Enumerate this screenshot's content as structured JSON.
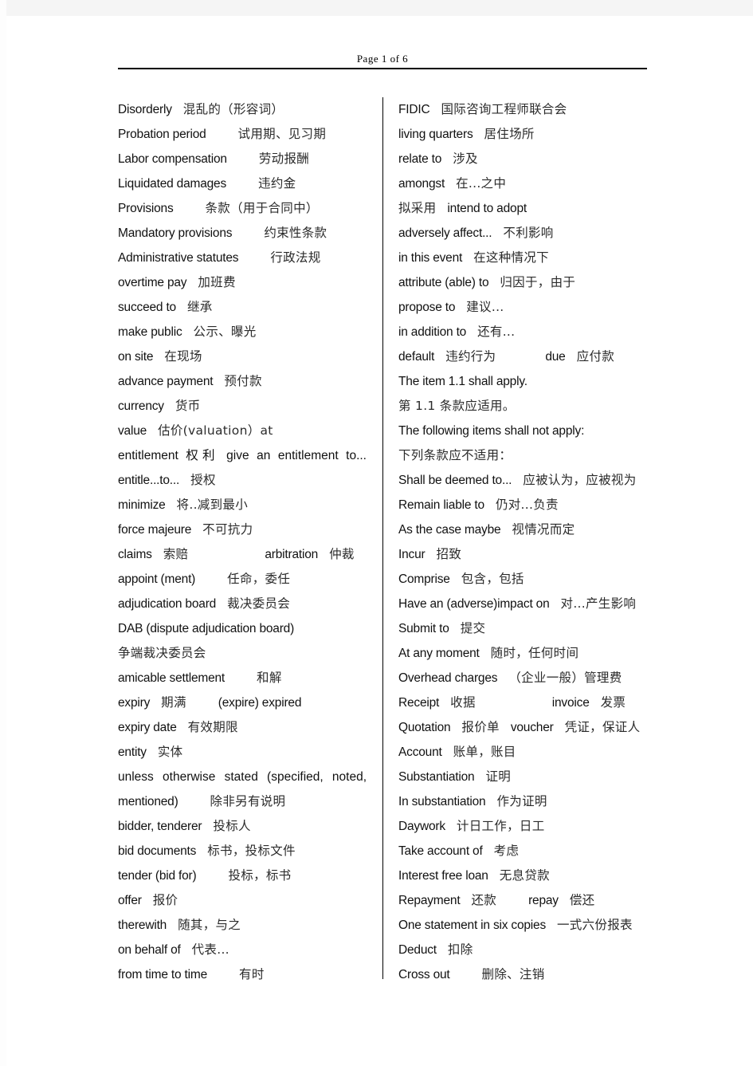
{
  "header": {
    "page_label": "Page 1 of 6"
  },
  "columns": {
    "left": [
      {
        "en": "Disorderly",
        "cn": "混乱的（形容词）",
        "gap": "gap-sm"
      },
      {
        "en": "Probation period",
        "cn": "试用期、见习期",
        "gap": "gap-md"
      },
      {
        "en": "Labor compensation",
        "cn": "劳动报酬",
        "gap": "gap-md"
      },
      {
        "en": "Liquidated damages",
        "cn": "违约金",
        "gap": "gap-md"
      },
      {
        "en": "Provisions",
        "cn": "条款（用于合同中）",
        "gap": "gap-md"
      },
      {
        "en": "Mandatory provisions",
        "cn": "约束性条款",
        "gap": "gap-md"
      },
      {
        "en": "Administrative statutes",
        "cn": "行政法规",
        "gap": "gap-md"
      },
      {
        "en": "overtime pay",
        "cn": "加班费",
        "gap": "gap-sm"
      },
      {
        "en": "succeed to",
        "cn": "继承",
        "gap": "gap-sm"
      },
      {
        "en": "make public",
        "cn": "公示、曝光",
        "gap": "gap-sm"
      },
      {
        "en": "on site",
        "cn": "在现场",
        "gap": "gap-sm"
      },
      {
        "en": "advance payment",
        "cn": "预付款",
        "gap": "gap-sm"
      },
      {
        "en": "currency",
        "cn": "货币",
        "gap": "gap-sm"
      },
      {
        "en": "value",
        "cn": "估价(valuation）at",
        "gap": "gap-sm"
      },
      {
        "justified": true,
        "text": "entitlement 权利 give an entitlement to..."
      },
      {
        "en": "entitle...to...",
        "cn": "授权",
        "gap": "gap-sm"
      },
      {
        "en": "minimize",
        "cn": "将..减到最小",
        "gap": "gap-sm"
      },
      {
        "en": "force majeure",
        "cn": "不可抗力",
        "gap": "gap-sm"
      },
      {
        "en": "claims",
        "cn": "索赔",
        "gap": "gap-sm",
        "en2": "arbitration",
        "cn2": "仲裁",
        "gap2": "gap-xl"
      },
      {
        "en": "appoint (ment)",
        "cn": "任命，委任",
        "gap": "gap-md"
      },
      {
        "en": "adjudication board",
        "cn": "裁决委员会",
        "gap": "gap-sm"
      },
      {
        "en": "DAB (dispute adjudication board)",
        "cn": "",
        "gap": "gap-sm"
      },
      {
        "en": "",
        "cn": "争端裁决委员会",
        "gap": ""
      },
      {
        "en": "amicable settlement",
        "cn": "和解",
        "gap": "gap-md"
      },
      {
        "en": "expiry",
        "cn": "期满",
        "gap": "gap-sm",
        "en2": "(expire) expired",
        "cn2": "",
        "gap2": "gap-md"
      },
      {
        "en": "expiry date",
        "cn": "有效期限",
        "gap": "gap-sm"
      },
      {
        "en": "entity",
        "cn": "实体",
        "gap": "gap-sm"
      },
      {
        "justified": true,
        "text": "unless otherwise stated (specified, noted,"
      },
      {
        "en": "mentioned)",
        "cn": "除非另有说明",
        "gap": "gap-md"
      },
      {
        "en": "bidder, tenderer",
        "cn": "投标人",
        "gap": "gap-sm"
      },
      {
        "en": "bid documents",
        "cn": "标书，投标文件",
        "gap": "gap-sm"
      },
      {
        "en": "tender (bid for)",
        "cn": "投标，标书",
        "gap": "gap-md"
      },
      {
        "en": "offer",
        "cn": "报价",
        "gap": "gap-sm"
      },
      {
        "en": "therewith",
        "cn": "随其，与之",
        "gap": "gap-sm"
      },
      {
        "en": "on behalf of",
        "cn": "代表...",
        "gap": "gap-sm"
      },
      {
        "en": "from time to time",
        "cn": "有时",
        "gap": "gap-md"
      }
    ],
    "right": [
      {
        "en": "FIDIC",
        "cn": "国际咨询工程师联合会",
        "gap": "gap-sm"
      },
      {
        "en": "living quarters",
        "cn": "居住场所",
        "gap": "gap-sm"
      },
      {
        "en": "relate to",
        "cn": "涉及",
        "gap": "gap-sm"
      },
      {
        "en": "amongst",
        "cn": "在...之中",
        "gap": "gap-sm"
      },
      {
        "cn_first": true,
        "cn": "拟采用",
        "en": "intend to adopt",
        "gap": "gap-sm"
      },
      {
        "en": "adversely affect...",
        "cn": "不利影响",
        "gap": "gap-sm"
      },
      {
        "en": "in this event",
        "cn": "在这种情况下",
        "gap": "gap-sm"
      },
      {
        "en": "attribute (able) to",
        "cn": "归因于，由于",
        "gap": "gap-sm"
      },
      {
        "en": "propose to",
        "cn": "建议...",
        "gap": "gap-sm"
      },
      {
        "en": "in addition to",
        "cn": "还有...",
        "gap": "gap-sm"
      },
      {
        "en": "default",
        "cn": "违约行为",
        "gap": "gap-sm",
        "en2": "due",
        "cn2": "应付款",
        "gap2": "gap-lg"
      },
      {
        "en": "The item 1.1 shall apply.",
        "cn": "",
        "gap": ""
      },
      {
        "en": "",
        "cn": "第 1.1 条款应适用。",
        "gap": ""
      },
      {
        "en": "The following items shall not apply:",
        "cn": "",
        "gap": ""
      },
      {
        "en": "",
        "cn": "下列条款应不适用：",
        "gap": ""
      },
      {
        "en": "Shall be deemed to...",
        "cn": "应被认为，应被视为",
        "gap": "gap-sm"
      },
      {
        "en": "Remain liable to",
        "cn": "仍对...负责",
        "gap": "gap-sm"
      },
      {
        "en": "As the case maybe",
        "cn": "视情况而定",
        "gap": "gap-sm"
      },
      {
        "en": "Incur",
        "cn": "招致",
        "gap": "gap-sm"
      },
      {
        "en": "Comprise",
        "cn": "包含，包括",
        "gap": "gap-sm"
      },
      {
        "en": "Have an (adverse)impact on",
        "cn": "对...产生影响",
        "gap": "gap-sm"
      },
      {
        "en": "Submit to",
        "cn": "提交",
        "gap": "gap-sm"
      },
      {
        "en": "At any moment",
        "cn": "随时，任何时间",
        "gap": "gap-sm"
      },
      {
        "en": "Overhead charges",
        "cn": "（企业一般）管理费",
        "gap": "gap-sm"
      },
      {
        "en": "Receipt",
        "cn": "收据",
        "gap": "gap-sm",
        "en2": "invoice",
        "cn2": "发票",
        "gap2": "gap-xl"
      },
      {
        "en": "Quotation",
        "cn": "报价单",
        "gap": "gap-sm",
        "en2": "voucher",
        "cn2": "凭证，保证人",
        "gap2": "gap-sm"
      },
      {
        "en": "Account",
        "cn": "账单，账目",
        "gap": "gap-sm"
      },
      {
        "en": "Substantiation",
        "cn": "证明",
        "gap": "gap-sm"
      },
      {
        "en": "In substantiation",
        "cn": "作为证明",
        "gap": "gap-sm"
      },
      {
        "en": "Daywork",
        "cn": "计日工作，日工",
        "gap": "gap-sm"
      },
      {
        "en": "Take account of",
        "cn": "考虑",
        "gap": "gap-sm"
      },
      {
        "en": "Interest free loan",
        "cn": "无息贷款",
        "gap": "gap-sm"
      },
      {
        "en": "Repayment",
        "cn": "还款",
        "gap": "gap-sm",
        "en2": "repay",
        "cn2": "偿还",
        "gap2": "gap-md"
      },
      {
        "en": "One statement in six copies",
        "cn": "一式六份报表",
        "gap": "gap-sm"
      },
      {
        "en": "Deduct",
        "cn": "扣除",
        "gap": "gap-sm"
      },
      {
        "en": "Cross out",
        "cn": "删除、注销",
        "gap": "gap-md"
      }
    ]
  }
}
